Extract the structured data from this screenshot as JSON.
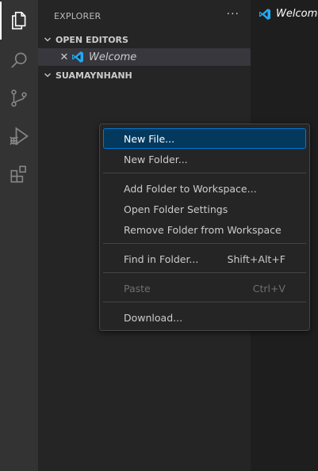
{
  "sidebar": {
    "title": "EXPLORER",
    "more_actions": "···",
    "open_editors_label": "OPEN EDITORS",
    "folder_label": "SUAMAYNHANH",
    "open_editors": [
      {
        "label": "Welcome",
        "close_glyph": "✕",
        "icon": "vscode-icon"
      }
    ]
  },
  "activity_bar": {
    "items": [
      {
        "icon": "files-icon",
        "active": true
      },
      {
        "icon": "search-icon"
      },
      {
        "icon": "source-control-icon"
      },
      {
        "icon": "run-debug-icon"
      },
      {
        "icon": "extensions-icon"
      }
    ]
  },
  "tab": {
    "label": "Welcome",
    "icon": "vscode-icon"
  },
  "context_menu": {
    "items": [
      {
        "label": "New File...",
        "highlight": true
      },
      {
        "label": "New Folder..."
      },
      {
        "label": "Add Folder to Workspace..."
      },
      {
        "label": "Open Folder Settings"
      },
      {
        "label": "Remove Folder from Workspace"
      },
      {
        "label": "Find in Folder...",
        "shortcut": "Shift+Alt+F"
      },
      {
        "label": "Paste",
        "shortcut": "Ctrl+V",
        "disabled": true
      },
      {
        "label": "Download..."
      }
    ]
  },
  "colors": {
    "activity_bar": "#333333",
    "sidebar": "#252526",
    "editor": "#1e1e1e",
    "menu_highlight": "#04395e",
    "accent": "#0078d4"
  }
}
